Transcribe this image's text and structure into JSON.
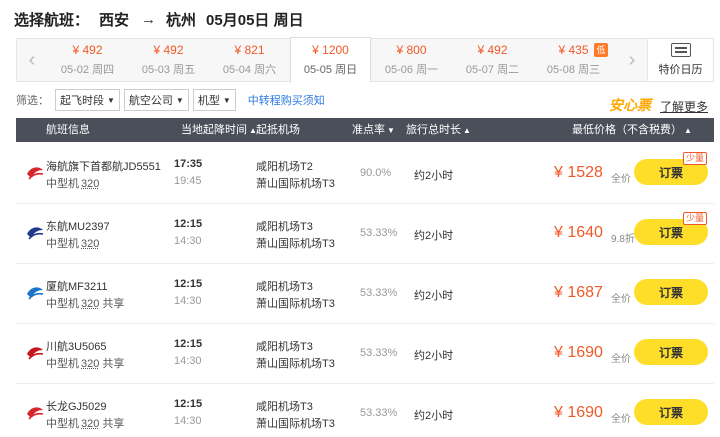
{
  "title": {
    "prefix": "选择航班：",
    "from": "西安",
    "arrow": "→",
    "to": "杭州",
    "date": "05月05日 周日"
  },
  "date_nav": {
    "prev_icon": "chevron-left-icon",
    "next_icon": "chevron-right-icon",
    "dates": [
      {
        "price": "¥ 492",
        "day": "05-02 周四"
      },
      {
        "price": "¥ 492",
        "day": "05-03 周五"
      },
      {
        "price": "¥ 821",
        "day": "05-04 周六"
      },
      {
        "price": "¥ 1200",
        "day": "05-05 周日",
        "active": true
      },
      {
        "price": "¥ 800",
        "day": "05-06 周一"
      },
      {
        "price": "¥ 492",
        "day": "05-07 周二"
      },
      {
        "price": "¥ 435",
        "day": "05-08 周三",
        "badge": "低"
      }
    ],
    "calendar_label": "特价日历"
  },
  "filters": {
    "label": "筛选：",
    "options": [
      "起飞时段",
      "航空公司",
      "机型"
    ],
    "transfer_link": "中转程购买须知"
  },
  "promo": {
    "anxin": "安心票",
    "learn_more": "了解更多"
  },
  "columns": {
    "info": "航班信息",
    "time": "当地起降时间",
    "airport": "起抵机场",
    "ontime": "准点率",
    "duration": "旅行总时长",
    "price": "最低价格（不含税费）"
  },
  "flights": [
    {
      "airline": "海航旗下首都航JD5551",
      "model": "中型机",
      "type": "320",
      "shared": "",
      "dep_time": "17:35",
      "arr_time": "19:45",
      "dep_airport": "咸阳机场T2",
      "arr_airport": "萧山国际机场T3",
      "ontime": "90.0%",
      "duration": "约2小时",
      "price": "¥ 1528",
      "note": "全价",
      "book": "订票",
      "badge": "少量",
      "color": "#d7252e"
    },
    {
      "airline": "东航MU2397",
      "model": "中型机",
      "type": "320",
      "shared": "",
      "dep_time": "12:15",
      "arr_time": "14:30",
      "dep_airport": "咸阳机场T3",
      "arr_airport": "萧山国际机场T3",
      "ontime": "53.33%",
      "duration": "约2小时",
      "price": "¥ 1640",
      "note": "9.8折",
      "book": "订票",
      "badge": "少量",
      "color": "#1f3a8a"
    },
    {
      "airline": "厦航MF3211",
      "model": "中型机",
      "type": "320",
      "shared": "共享",
      "dep_time": "12:15",
      "arr_time": "14:30",
      "dep_airport": "咸阳机场T3",
      "arr_airport": "萧山国际机场T3",
      "ontime": "53.33%",
      "duration": "约2小时",
      "price": "¥ 1687",
      "note": "全价",
      "book": "订票",
      "badge": "",
      "color": "#1b74c5"
    },
    {
      "airline": "川航3U5065",
      "model": "中型机",
      "type": "320",
      "shared": "共享",
      "dep_time": "12:15",
      "arr_time": "14:30",
      "dep_airport": "咸阳机场T3",
      "arr_airport": "萧山国际机场T3",
      "ontime": "53.33%",
      "duration": "约2小时",
      "price": "¥ 1690",
      "note": "全价",
      "book": "订票",
      "badge": "",
      "color": "#c4161c"
    },
    {
      "airline": "长龙GJ5029",
      "model": "中型机",
      "type": "320",
      "shared": "共享",
      "dep_time": "12:15",
      "arr_time": "14:30",
      "dep_airport": "咸阳机场T3",
      "arr_airport": "萧山国际机场T3",
      "ontime": "53.33%",
      "duration": "约2小时",
      "price": "¥ 1690",
      "note": "全价",
      "book": "订票",
      "badge": "",
      "color": "#d7252e"
    }
  ]
}
